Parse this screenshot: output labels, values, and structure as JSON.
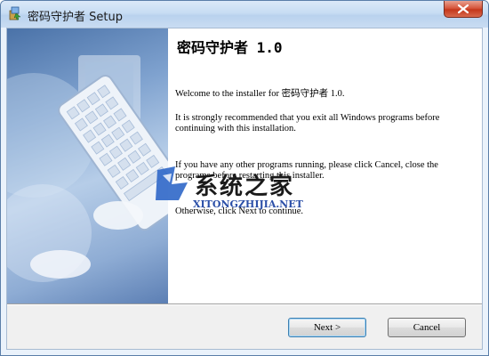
{
  "window": {
    "title": "密码守护者 Setup",
    "icons": {
      "app": "installer-icon",
      "close": "close-icon"
    }
  },
  "content": {
    "heading": "密码守护者 1.0",
    "paragraphs": [
      "Welcome to the installer for 密码守护者 1.0.",
      "It is strongly recommended that you exit all Windows programs before continuing with this installation.",
      "If you have any other programs running, please click Cancel, close the programs before restarting this installer.",
      "Otherwise, click Next to continue."
    ]
  },
  "buttons": {
    "next": "Next >",
    "cancel": "Cancel"
  },
  "watermark": {
    "brand": "系统之家",
    "url": "XITONGZHIJIA.NET"
  },
  "colors": {
    "close_button": "#c4371b",
    "titlebar": "#c7dcf3",
    "side_panel": "#7fa2cf"
  }
}
